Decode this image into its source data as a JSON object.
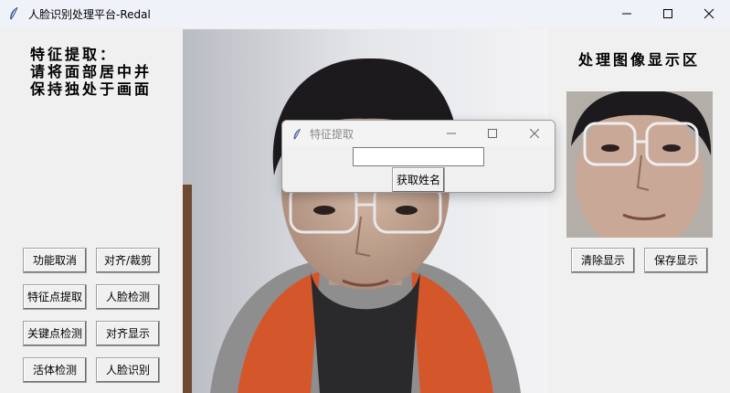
{
  "window": {
    "title": "人脸识别处理平台-Redal",
    "controls": [
      "minimize-icon",
      "maximize-icon",
      "close-icon"
    ]
  },
  "instructions": {
    "lines": [
      "特征提取：",
      "请将面部居中并",
      "保持独处于画面"
    ]
  },
  "buttons": {
    "cancel_function": "功能取消",
    "align_crop": "对齐/裁剪",
    "feature_extract": "特征点提取",
    "face_detect": "人脸检测",
    "keypoint_detect": "关键点检测",
    "align_display": "对齐显示",
    "liveness_detect": "活体检测",
    "face_recognize": "人脸识别",
    "clear_display": "清除显示",
    "save_display": "保存显示"
  },
  "display_area": {
    "title": "处理图像显示区"
  },
  "dialog": {
    "title": "特征提取",
    "name_input": {
      "value": "",
      "placeholder": ""
    },
    "get_name_button": "获取姓名"
  },
  "colors": {
    "window_bg": "#f0f0f0",
    "titlebar_bg": "#eff3f9",
    "hoodie_orange": "#d4572c",
    "hoodie_gray": "#8e8e8e"
  }
}
